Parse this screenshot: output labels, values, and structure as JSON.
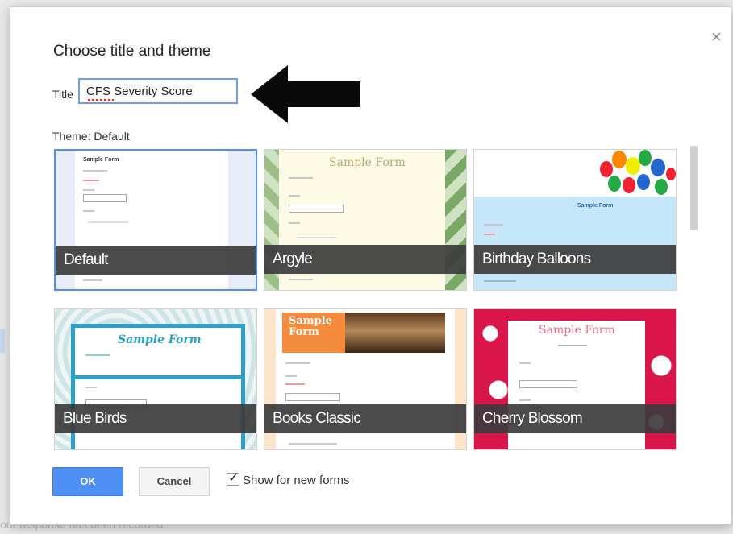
{
  "dialog": {
    "title": "Choose title and theme",
    "close_glyph": "×",
    "title_label": "Title",
    "title_value": "CFS Severity Score",
    "theme_label": "Theme: Default"
  },
  "themes": [
    {
      "label": "Default",
      "selected": true,
      "sample": "Sample Form"
    },
    {
      "label": "Argyle",
      "selected": false,
      "sample": "Sample Form"
    },
    {
      "label": "Birthday Balloons",
      "selected": false,
      "sample": "Sample Form"
    },
    {
      "label": "Blue Birds",
      "selected": false,
      "sample": "Sample Form"
    },
    {
      "label": "Books Classic",
      "selected": false,
      "sample": "Sample Form"
    },
    {
      "label": "Cherry Blossom",
      "selected": false,
      "sample": "Sample Form"
    }
  ],
  "buttons": {
    "ok": "OK",
    "cancel": "Cancel"
  },
  "show_for_new_forms": {
    "label": "Show for new forms",
    "checked": true
  },
  "background": {
    "text": "our response has been recorded."
  },
  "colors": {
    "accent": "#4d8ff3",
    "selected_border": "#4d90fe",
    "label_overlay": "#3c3c3c"
  },
  "icons": [
    "close-icon",
    "arrow-left-icon",
    "checkmark-icon"
  ]
}
